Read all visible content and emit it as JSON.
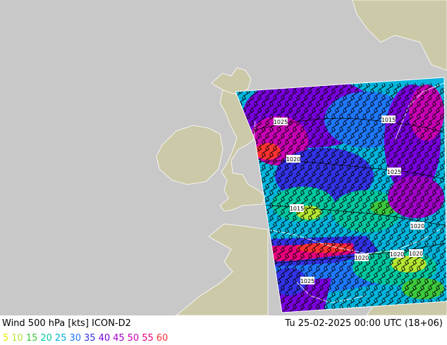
{
  "title": "Wind 500 hPa [kts] ICON-D2",
  "datetime": "Tu 25-02-2025 00:00 UTC (18+06)",
  "legend": [
    {
      "label": "5",
      "color": "#e8e800"
    },
    {
      "label": "10",
      "color": "#b4e632"
    },
    {
      "label": "15",
      "color": "#3cc83c"
    },
    {
      "label": "20",
      "color": "#00c8a0"
    },
    {
      "label": "25",
      "color": "#00b4dc"
    },
    {
      "label": "30",
      "color": "#1e78ff"
    },
    {
      "label": "35",
      "color": "#3232e6"
    },
    {
      "label": "40",
      "color": "#7800dc"
    },
    {
      "label": "45",
      "color": "#a000c8"
    },
    {
      "label": "50",
      "color": "#c800b4"
    },
    {
      "label": "55",
      "color": "#e6007d"
    },
    {
      "label": "60",
      "color": "#ff3232"
    }
  ],
  "isobar_labels": [
    "1025",
    "1015",
    "1020",
    "1025",
    "1015",
    "1020",
    "1020",
    "1020",
    "1025",
    "1020"
  ],
  "colors": {
    "land": "#ccc9a8",
    "sea": "#c8c8c8",
    "coast": "#ffffff"
  }
}
